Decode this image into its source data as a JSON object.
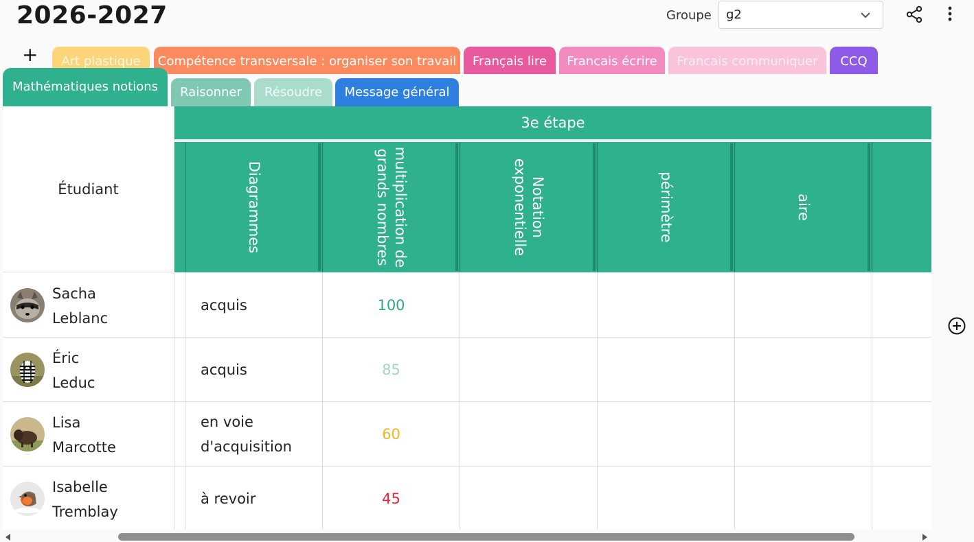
{
  "header": {
    "year": "2026-2027",
    "group_label": "Groupe",
    "group_value": "g2",
    "add_tab_symbol": "+"
  },
  "tabs_row1": [
    {
      "label": "Art plastique",
      "color": "#fcd47a"
    },
    {
      "label": "Compétence transversale : organiser son travail",
      "color": "#fb8a5e"
    },
    {
      "label": "Français lire",
      "color": "#e85a9d"
    },
    {
      "label": "Francais écrire",
      "color": "#f28cc0"
    },
    {
      "label": "Francais communiquer",
      "color": "#f9c3dc"
    },
    {
      "label": "CCQ",
      "color": "#8e5be8"
    }
  ],
  "tabs_row2": [
    {
      "label": "Mathématiques notions",
      "color": "#2fb08e",
      "active": true
    },
    {
      "label": "Raisonner",
      "color": "#7fc9b2"
    },
    {
      "label": "Résoudre",
      "color": "#a9dccc"
    },
    {
      "label": "Message général",
      "color": "#2e80e0"
    }
  ],
  "table": {
    "student_header": "Étudiant",
    "stage_header": "3e étape",
    "columns": [
      {
        "lines": [
          "Diagrammes"
        ]
      },
      {
        "lines": [
          "multiplication de",
          "grands nombres"
        ]
      },
      {
        "lines": [
          "Notation",
          "exponentielle"
        ]
      },
      {
        "lines": [
          "périmètre"
        ]
      },
      {
        "lines": [
          "aire"
        ]
      }
    ],
    "rows": [
      {
        "first": "Sacha",
        "last": "Leblanc",
        "avatar": "raccoon",
        "diagrammes": [
          "acquis"
        ],
        "multiplication": "100",
        "score_color": "#2fa886"
      },
      {
        "first": "Éric",
        "last": "Leduc",
        "avatar": "zebra",
        "diagrammes": [
          "acquis"
        ],
        "multiplication": "85",
        "score_color": "#9fd6c4"
      },
      {
        "first": "Lisa",
        "last": "Marcotte",
        "avatar": "bison",
        "diagrammes": [
          "en voie",
          "d'acquisition"
        ],
        "multiplication": "60",
        "score_color": "#f2b51c"
      },
      {
        "first": "Isabelle",
        "last": "Tremblay",
        "avatar": "robin",
        "diagrammes": [
          "à revoir"
        ],
        "multiplication": "45",
        "score_color": "#e02a3a"
      }
    ]
  },
  "icons": {
    "share": "share-icon",
    "more": "more-vertical-icon",
    "dropdown": "chevron-down-icon",
    "add_column": "plus-circle-icon"
  }
}
